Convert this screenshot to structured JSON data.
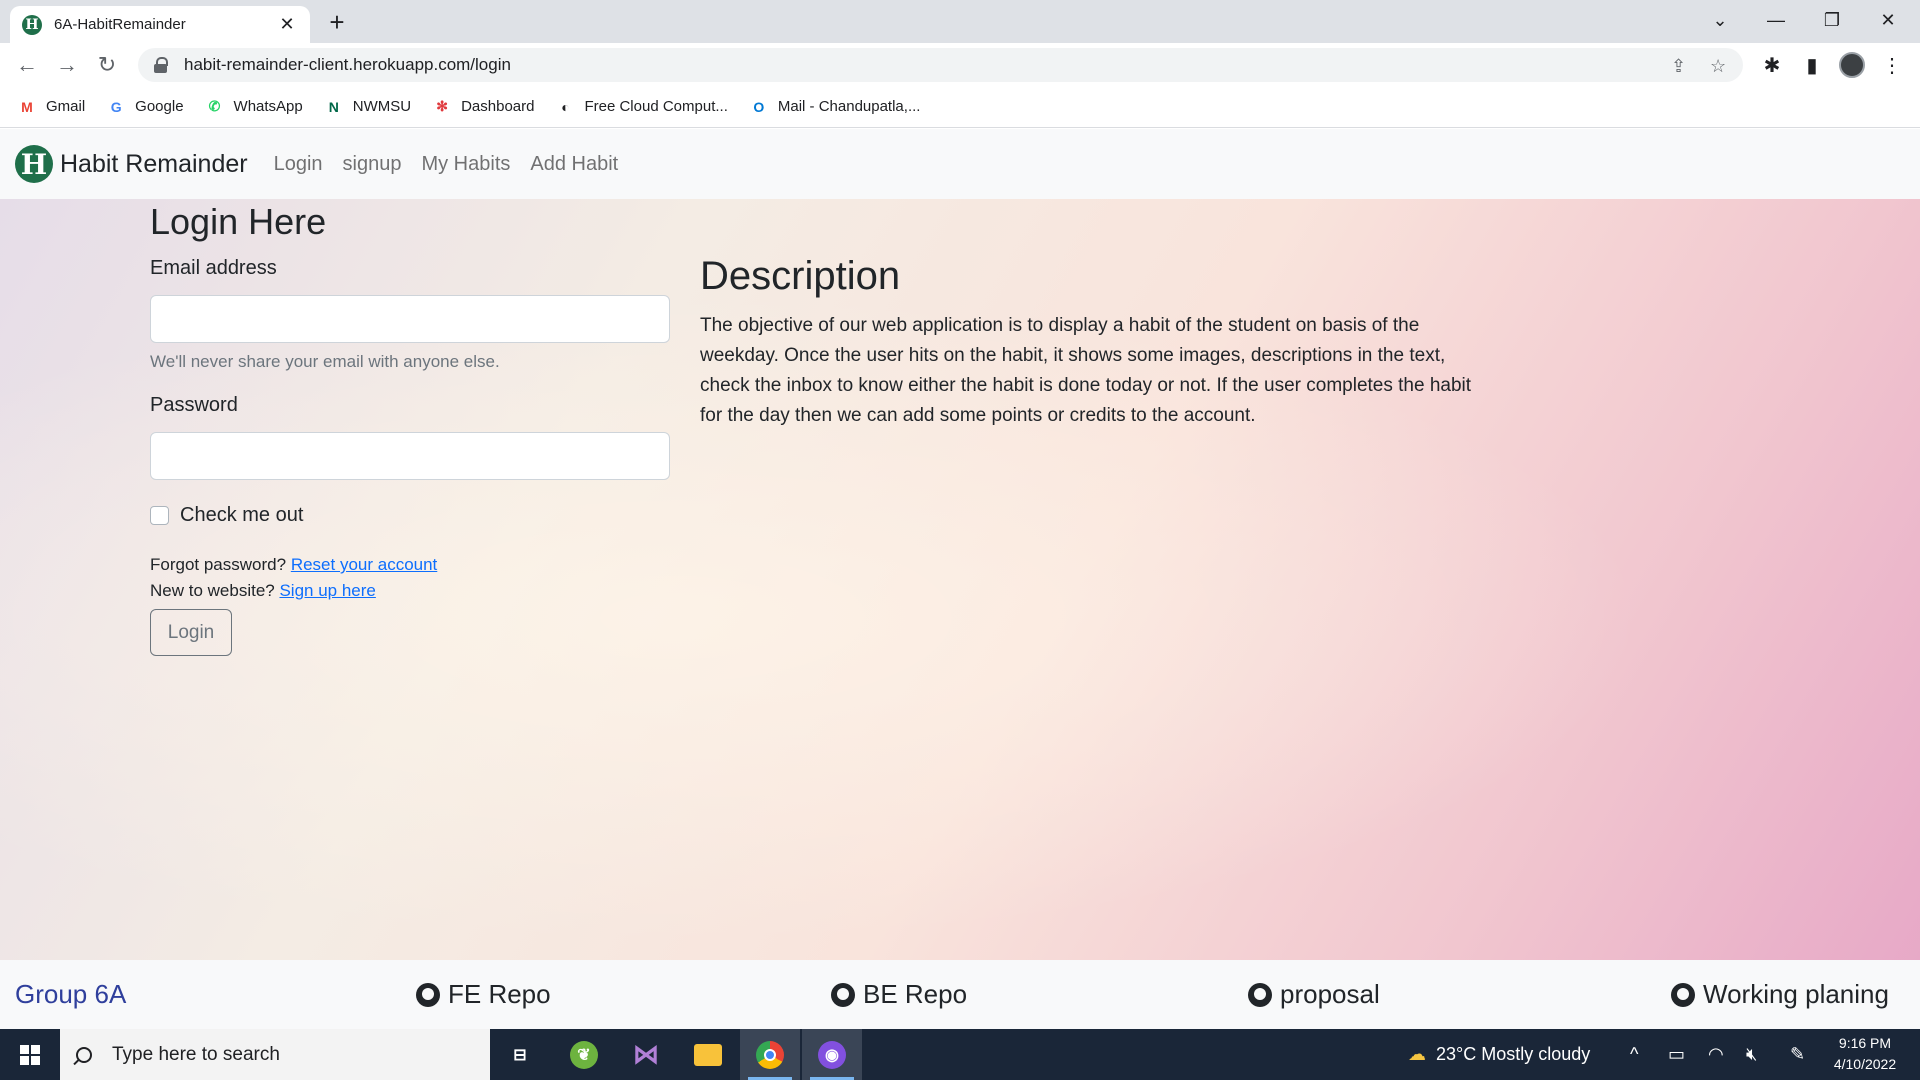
{
  "browser": {
    "tab_title": "6A-HabitRemainder",
    "tab_favicon": "H",
    "url": "habit-remainder-client.herokuapp.com/login",
    "bookmarks": [
      {
        "label": "Gmail",
        "icon": "gmail-icon",
        "glyph": "M",
        "color": "#ea4335"
      },
      {
        "label": "Google",
        "icon": "google-icon",
        "glyph": "G",
        "color": "#4285f4"
      },
      {
        "label": "WhatsApp",
        "icon": "whatsapp-icon",
        "glyph": "✆",
        "color": "#25d366"
      },
      {
        "label": "NWMSU",
        "icon": "nwmsu-icon",
        "glyph": "N",
        "color": "#006747"
      },
      {
        "label": "Dashboard",
        "icon": "dashboard-icon",
        "glyph": "✻",
        "color": "#e03a3e"
      },
      {
        "label": "Free Cloud Comput...",
        "icon": "globe-icon",
        "glyph": "◐",
        "color": "#202124"
      },
      {
        "label": "Mail - Chandupatla,...",
        "icon": "outlook-icon",
        "glyph": "O",
        "color": "#0078d4"
      }
    ]
  },
  "app": {
    "brand_logo": "H",
    "brand": "Habit Remainder",
    "nav": [
      "Login",
      "signup",
      "My Habits",
      "Add Habit"
    ]
  },
  "login": {
    "title": "Login Here",
    "email_label": "Email address",
    "email_value": "",
    "email_help": "We'll never share your email with anyone else.",
    "password_label": "Password",
    "password_value": "",
    "checkbox_label": "Check me out",
    "checkbox_checked": false,
    "forgot_text": "Forgot password?",
    "reset_link": "Reset your account",
    "new_text": "New to website?",
    "signup_link": "Sign up here",
    "button": "Login"
  },
  "description": {
    "title": "Description",
    "text": "The objective of our web application is to display a habit of the student on basis of the weekday. Once the user hits on the habit, it shows some images, descriptions in the text, check the inbox to know either the habit is done today or not. If the user completes the habit for the day then we can add some points or credits to the account."
  },
  "footer": {
    "group": "Group 6A",
    "links": [
      "FE Repo",
      "BE Repo",
      "proposal",
      "Working planing"
    ]
  },
  "taskbar": {
    "search_placeholder": "Type here to search",
    "weather": "23°C  Mostly cloudy",
    "time": "9:16 PM",
    "date": "4/10/2022"
  }
}
